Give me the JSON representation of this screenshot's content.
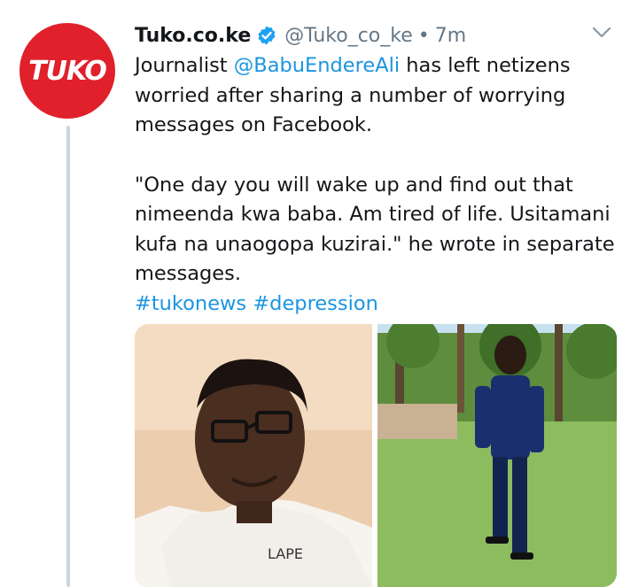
{
  "account": {
    "avatar_text": "TUKO",
    "name": "Tuko.co.ke",
    "handle": "@Tuko_co_ke",
    "separator": "•",
    "time": "7m"
  },
  "tweet": {
    "line1_prefix": "Journalist ",
    "mention": "@BabuEndereAli",
    "line1_suffix": " has left netizens worried after sharing a number of worrying messages on Facebook.",
    "quote": "\"One day you will wake up and find out that nimeenda kwa baba. Am tired of life. Usitamani kufa na unaogopa kuzirai.\" he wrote in separate messages.",
    "hashtags": [
      "#tukonews",
      "#depression"
    ]
  },
  "colors": {
    "brand_red": "#e0202b",
    "link_blue": "#1b95e0",
    "verified_blue": "#1da1f2",
    "muted": "#657786"
  },
  "icons": {
    "verified": "verified-badge-icon",
    "chevron": "chevron-down-icon"
  },
  "media": {
    "photo_shirt_text": "LAPE"
  }
}
